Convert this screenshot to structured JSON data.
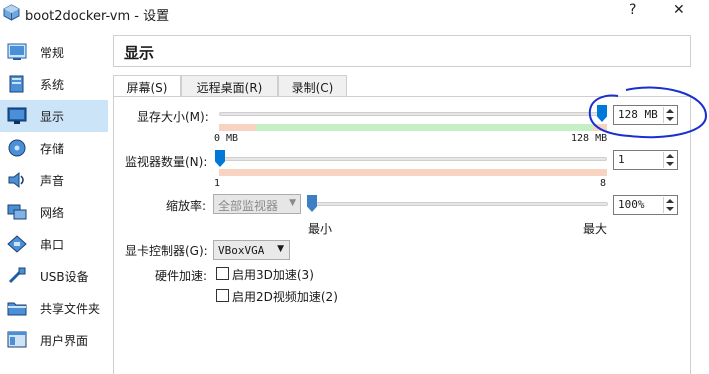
{
  "window": {
    "title": "boot2docker-vm - 设置",
    "help_label": "?",
    "close_label": "✕"
  },
  "sidebar": {
    "items": [
      {
        "label": "常规",
        "icon": "general-icon"
      },
      {
        "label": "系统",
        "icon": "system-icon"
      },
      {
        "label": "显示",
        "icon": "display-icon",
        "selected": true
      },
      {
        "label": "存储",
        "icon": "storage-icon"
      },
      {
        "label": "声音",
        "icon": "audio-icon"
      },
      {
        "label": "网络",
        "icon": "network-icon"
      },
      {
        "label": "串口",
        "icon": "serial-port-icon"
      },
      {
        "label": "USB设备",
        "icon": "usb-icon"
      },
      {
        "label": "共享文件夹",
        "icon": "shared-folder-icon"
      },
      {
        "label": "用户界面",
        "icon": "user-interface-icon"
      }
    ]
  },
  "header": {
    "title": "显示"
  },
  "tabs": [
    {
      "label": "屏幕(S)",
      "active": true
    },
    {
      "label": "远程桌面(R)"
    },
    {
      "label": "录制(C)"
    }
  ],
  "screen": {
    "video_memory": {
      "label": "显存大小(M):",
      "value": "128 MB",
      "min_label": "0 MB",
      "max_label": "128 MB",
      "fraction": 1.0
    },
    "monitor_count": {
      "label": "监视器数量(N):",
      "value": "1",
      "min_label": "1",
      "max_label": "8",
      "fraction": 0.0
    },
    "scale_factor": {
      "label": "缩放率:",
      "combo_value": "全部监视器",
      "value": "100%",
      "min_label": "最小",
      "max_label": "最大",
      "fraction": 0.0
    },
    "graphics_controller": {
      "label": "显卡控制器(G):",
      "value": "VBoxVGA"
    },
    "acceleration": {
      "label": "硬件加速:",
      "options": [
        {
          "label": "启用3D加速(3)",
          "checked": false
        },
        {
          "label": "启用2D视频加速(2)",
          "checked": false
        }
      ]
    }
  },
  "colors": {
    "accent": "#0078d7",
    "selection": "#cce4f7",
    "range_ok": "#c6efc6",
    "range_warn": "#f8d3c1",
    "annotation": "#1a2fd1"
  }
}
